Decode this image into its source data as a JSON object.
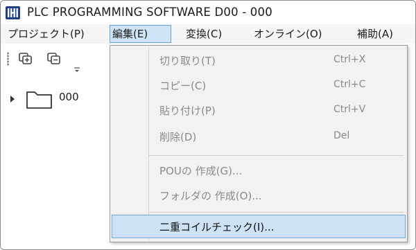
{
  "window": {
    "title": "PLC PROGRAMMING SOFTWARE D00  - 000",
    "icon": "app-logo-icon"
  },
  "menubar": {
    "items": [
      {
        "label": "プロジェクト(P)"
      },
      {
        "label": "編集(E)"
      },
      {
        "label": "変換(C)"
      },
      {
        "label": "オンライン(O)"
      },
      {
        "label": "補助(A)"
      }
    ]
  },
  "toolbar": {
    "buttons": [
      "add-device-icon",
      "remove-device-icon",
      "toolbar-overflow-icon"
    ]
  },
  "tree": {
    "root": {
      "label": "000",
      "icon": "folder-icon",
      "expanded": false
    }
  },
  "edit_menu": {
    "items": [
      {
        "label": "切り取り(T)",
        "shortcut": "Ctrl+X",
        "enabled": false
      },
      {
        "label": "コピー(C)",
        "shortcut": "Ctrl+C",
        "enabled": false
      },
      {
        "label": "貼り付け(P)",
        "shortcut": "Ctrl+V",
        "enabled": false
      },
      {
        "label": "削除(D)",
        "shortcut": "Del",
        "enabled": false
      },
      {
        "label": "POUの 作成(G)...",
        "enabled": false
      },
      {
        "label": "フォルダの 作成(O)...",
        "enabled": false
      },
      {
        "label": "二重コイルチェック(I)...",
        "enabled": true,
        "highlighted": true
      }
    ]
  },
  "colors": {
    "accent": "#1f3f8c",
    "highlight_bg": "#cde3f5",
    "highlight_border": "#6fa6d8",
    "disabled_text": "#8a8a8a"
  }
}
